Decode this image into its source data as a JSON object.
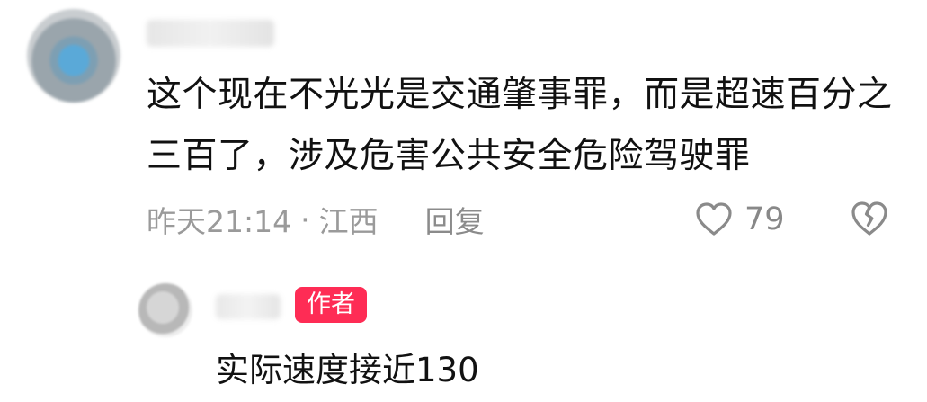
{
  "comment": {
    "text": "这个现在不光光是交通肇事罪，而是超速百分之三百了，涉及危害公共安全危险驾驶罪",
    "time": "昨天21:14",
    "location": "江西",
    "reply_label": "回复",
    "like_count": "79",
    "icons": {
      "like": "heart-outline-icon",
      "dislike": "broken-heart-icon"
    }
  },
  "reply": {
    "badge": "作者",
    "text": "实际速度接近130",
    "colors": {
      "badge": "#fe2c55"
    }
  }
}
